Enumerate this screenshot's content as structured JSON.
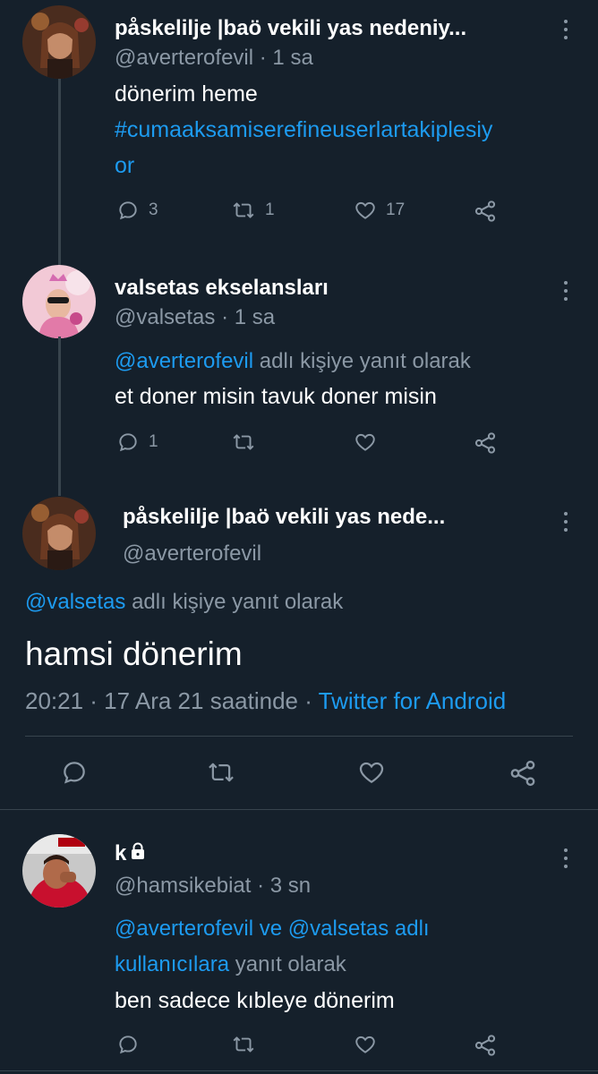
{
  "tweets": [
    {
      "display_name": "påskelilje |baö vekili yas nedeniy...",
      "handle": "@averterofevil",
      "time": "· 1 sa",
      "text_line1": "dönerim heme",
      "hashtag_line1": "#cumaaksamiserefineuserlartakiplesiy",
      "hashtag_line2": "or",
      "reply_count": "3",
      "retweet_count": "1",
      "like_count": "17"
    },
    {
      "display_name": "valsetas ekselansları",
      "handle": "@valsetas",
      "time": "· 1 sa",
      "reply_mention": "@averterofevil",
      "reply_suffix": "adlı kişiye yanıt olarak",
      "text": "et doner misin tavuk doner misin",
      "reply_count": "1"
    }
  ],
  "main_tweet": {
    "display_name": "påskelilje |baö vekili yas nede...",
    "handle": "@averterofevil",
    "reply_mention": "@valsetas",
    "reply_suffix": "adlı kişiye yanıt olarak",
    "text": "hamsi dönerim",
    "timestamp": "20:21 · 17 Ara 21 saatinde ·",
    "source": "Twitter for Android"
  },
  "reply_tweet": {
    "display_name": "k",
    "handle": "@hamsikebiat",
    "time": "· 3 sn",
    "mention1": "@averterofevil",
    "connector": "ve",
    "mention2": "@valsetas",
    "mention_suffix": "adlı",
    "mention_line2_link": "kullanıcılara",
    "mention_line2_rest": "yanıt olarak",
    "text": "ben sadece kıbleye dönerim"
  },
  "icons": {
    "reply": "reply-icon",
    "retweet": "retweet-icon",
    "like": "heart-icon",
    "share": "share-icon",
    "more": "more-icon",
    "lock": "lock-icon"
  },
  "colors": {
    "background": "#15202b",
    "link": "#1d9bf0",
    "secondary_text": "#8b98a5",
    "divider": "#38444d"
  }
}
